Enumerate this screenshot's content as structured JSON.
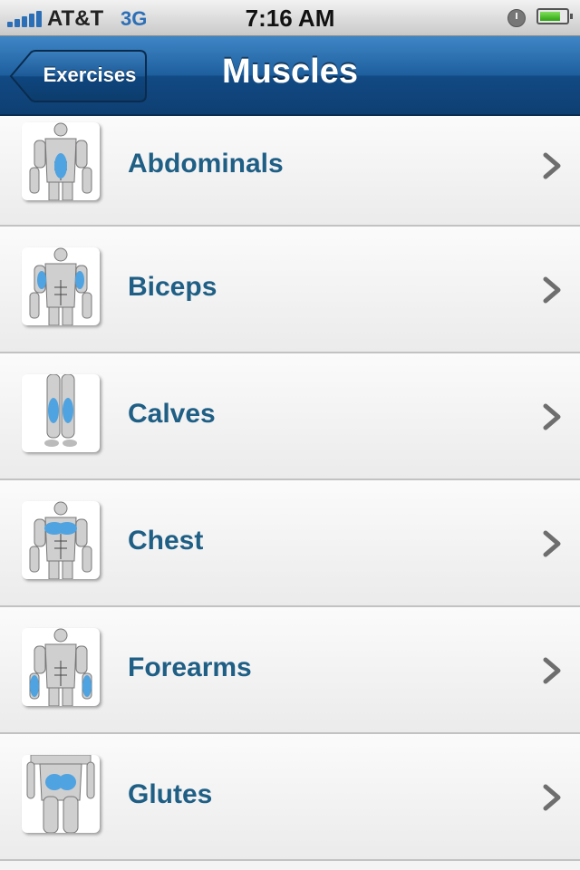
{
  "status_bar": {
    "carrier": "AT&T",
    "network": "3G",
    "time": "7:16 AM",
    "signal_bars": 5,
    "battery_level": 0.8,
    "icons": [
      "signal-icon",
      "alarm-icon",
      "battery-icon"
    ]
  },
  "nav": {
    "back_label": "Exercises",
    "title": "Muscles"
  },
  "colors": {
    "nav_blue": "#1e5f9e",
    "label_blue": "#1f5f85",
    "muscle_highlight": "#4fa3e0"
  },
  "muscles": [
    {
      "label": "Abdominals",
      "icon": "abdominals-anatomy-icon"
    },
    {
      "label": "Biceps",
      "icon": "biceps-anatomy-icon"
    },
    {
      "label": "Calves",
      "icon": "calves-anatomy-icon"
    },
    {
      "label": "Chest",
      "icon": "chest-anatomy-icon"
    },
    {
      "label": "Forearms",
      "icon": "forearms-anatomy-icon"
    },
    {
      "label": "Glutes",
      "icon": "glutes-anatomy-icon"
    }
  ]
}
